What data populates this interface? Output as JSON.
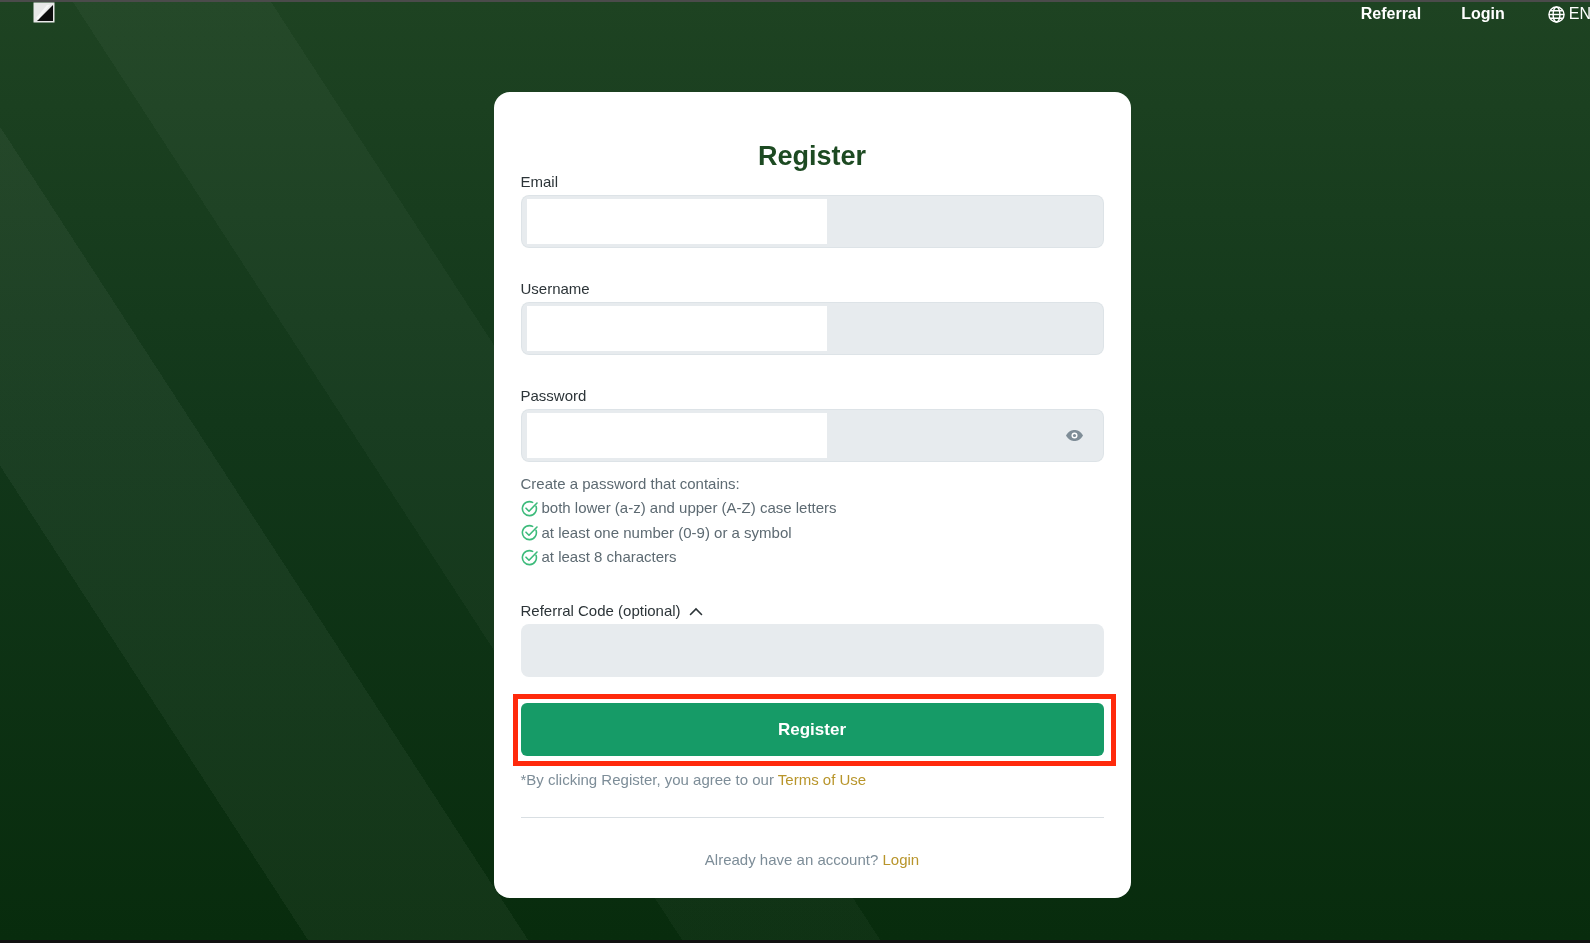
{
  "nav": {
    "links": [
      {
        "label": "Referral"
      },
      {
        "label": "Login"
      }
    ],
    "language": "EN"
  },
  "form": {
    "title": "Register",
    "fields": [
      {
        "label": "Email",
        "kind": "email"
      },
      {
        "label": "Username",
        "kind": "text"
      },
      {
        "label": "Password",
        "kind": "password"
      }
    ],
    "password_hint": {
      "title": "Create a password that contains:",
      "rules": [
        {
          "text": "both lower (a-z) and upper (A-Z) case letters",
          "met": true
        },
        {
          "text": "at least one number (0-9) or a symbol",
          "met": true
        },
        {
          "text": "at least 8 characters",
          "met": true
        }
      ]
    },
    "referral": {
      "label": "Referral Code (optional)",
      "expanded": true
    },
    "submit": {
      "label": "Register",
      "highlighted": true
    },
    "terms": {
      "text": "*By clicking Register, you agree to our",
      "link": "Terms of Use"
    },
    "footer": {
      "text": "Already have an account?",
      "link": "Login"
    }
  }
}
